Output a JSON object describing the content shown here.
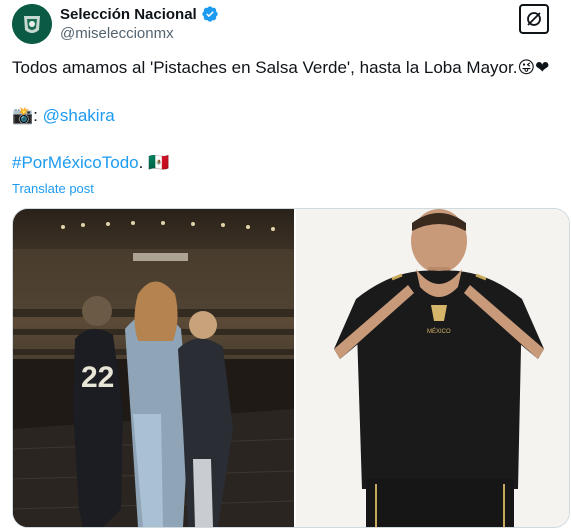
{
  "post": {
    "display_name": "Selección Nacional",
    "handle": "@miseleccionmx",
    "text_line1": "Todos amamos al 'Pistaches en Salsa Verde', hasta la Loba Mayor.",
    "line1_emojis": "😜❤",
    "camera_emoji": "📸",
    "colon": ":",
    "mention": "@shakira",
    "hashtag": "#PorMéxicoTodo",
    "period": ".",
    "flag_emoji": "🇲🇽",
    "translate_label": "Translate post"
  },
  "icons": {
    "verified": "verified-badge-icon",
    "grok": "grok-icon"
  },
  "colors": {
    "link": "#1d9bf0",
    "verified": "#1d9bf0",
    "text": "#0f1419",
    "secondary": "#536471"
  }
}
